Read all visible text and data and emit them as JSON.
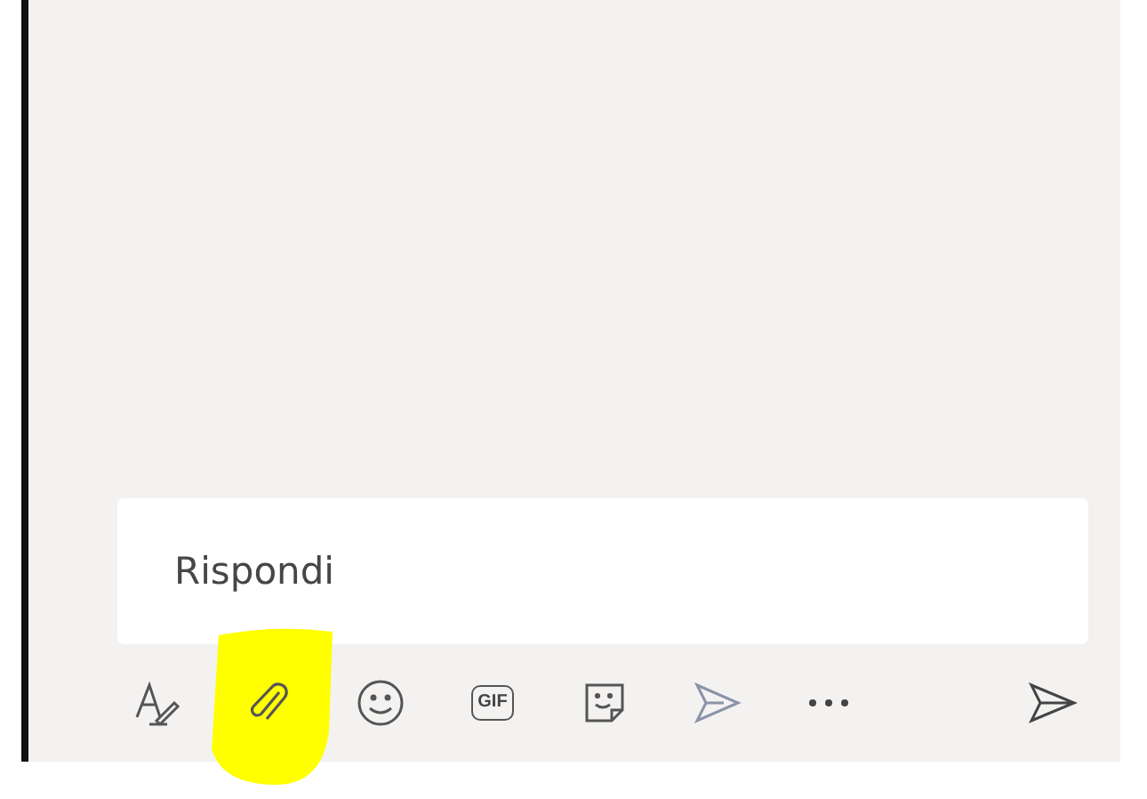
{
  "compose": {
    "placeholder": "Rispondi"
  },
  "toolbar": {
    "gif_label": "GIF",
    "tools": [
      {
        "kind": "format",
        "highlighted": false
      },
      {
        "kind": "attach",
        "highlighted": true
      },
      {
        "kind": "emoji",
        "highlighted": false
      },
      {
        "kind": "gif",
        "highlighted": false
      },
      {
        "kind": "sticker",
        "highlighted": false
      },
      {
        "kind": "schedule",
        "highlighted": false
      },
      {
        "kind": "more",
        "highlighted": false
      }
    ]
  }
}
